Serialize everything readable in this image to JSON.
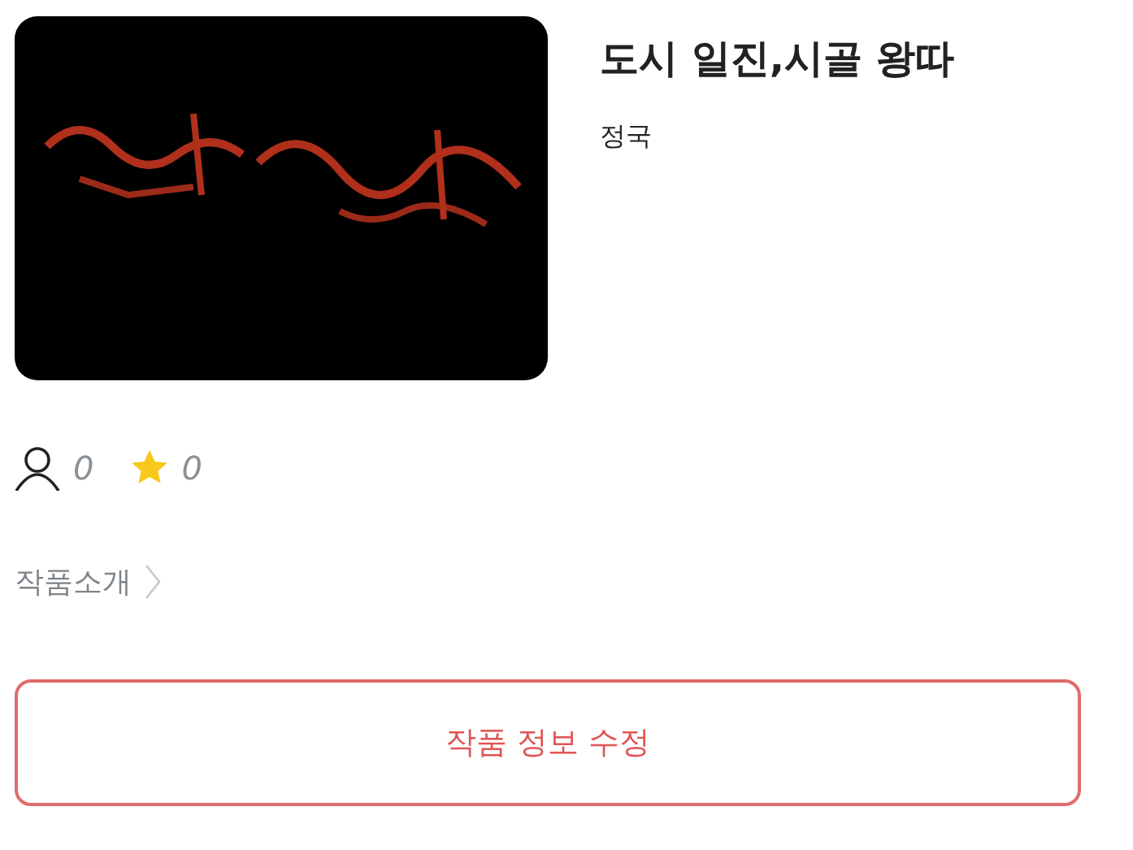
{
  "work": {
    "title": "도시 일진,시골 왕따",
    "author": "정국"
  },
  "stats": [
    {
      "kind": "readers",
      "value": "0"
    },
    {
      "kind": "stars",
      "value": "0"
    }
  ],
  "intro_link": {
    "label": "작품소개"
  },
  "edit_button": {
    "label": "작품 정보 수정"
  }
}
